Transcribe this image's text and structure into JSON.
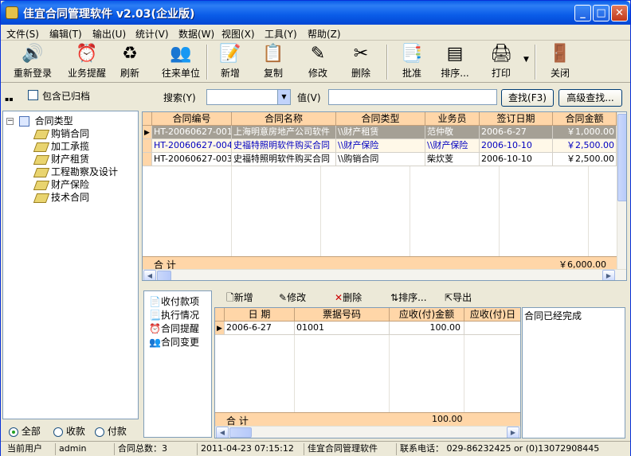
{
  "window": {
    "title": "佳宜合同管理软件 v2.03(企业版)"
  },
  "menu": [
    "文件(S)",
    "编辑(T)",
    "输出(U)",
    "统计(V)",
    "数据(W)",
    "视图(X)",
    "工具(Y)",
    "帮助(Z)"
  ],
  "toolbar": [
    {
      "label": "重新登录",
      "icon": "relogin-icon"
    },
    {
      "label": "业务提醒",
      "icon": "reminder-icon"
    },
    {
      "label": "刷新",
      "icon": "refresh-icon"
    },
    {
      "label": "往来单位",
      "icon": "partners-icon"
    },
    {
      "label": "新增",
      "icon": "new-icon"
    },
    {
      "label": "复制",
      "icon": "copy-icon"
    },
    {
      "label": "修改",
      "icon": "edit-icon"
    },
    {
      "label": "删除",
      "icon": "delete-icon"
    },
    {
      "label": "批准",
      "icon": "approve-icon"
    },
    {
      "label": "排序...",
      "icon": "sort-icon"
    },
    {
      "label": "打印",
      "icon": "print-icon"
    },
    {
      "label": "关闭",
      "icon": "close-door-icon"
    }
  ],
  "search": {
    "include_archived": "包含已归档",
    "search_label": "搜索(Y)",
    "value_label": "值(V)",
    "find_btn": "查找(F3)",
    "advanced_btn": "高级查找..."
  },
  "tree": {
    "root": "合同类型",
    "children": [
      "购销合同",
      "加工承揽",
      "财产租赁",
      "工程勘察及设计",
      "财产保险",
      "技术合同"
    ]
  },
  "contracts": {
    "headers": [
      "合同编号",
      "合同名称",
      "合同类型",
      "业务员",
      "签订日期",
      "合同金额"
    ],
    "rows": [
      [
        "HT-20060627-001",
        "上海明意房地产公司软件",
        "\\\\财产租赁",
        "范仲敬",
        "2006-6-27",
        "￥1,000.00"
      ],
      [
        "HT-20060627-004",
        "史福特照明软件购买合同",
        "\\\\财产保险",
        "\\\\财产保险",
        "2006-10-10",
        "￥2,500.00"
      ],
      [
        "HT-20060627-003",
        "史福特照明软件购买合同",
        "\\\\购销合同",
        "柴炊芰",
        "2006-10-10",
        "￥2,500.00"
      ]
    ],
    "total_label": "合 计",
    "total_amount": "￥6,000.00"
  },
  "detail": {
    "tabs": [
      "收付款项",
      "执行情况",
      "合同提醒",
      "合同变更"
    ],
    "toolbar": [
      "新增",
      "修改",
      "删除",
      "排序...",
      "导出"
    ],
    "headers": [
      "日   期",
      "票据号码",
      "应收(付)金额",
      "应收(付)日"
    ],
    "rows": [
      [
        "2006-6-27",
        "01001",
        "100.00",
        ""
      ]
    ],
    "total_label": "合 计",
    "total_amount": "100.00",
    "note": "合同已经完成"
  },
  "filter": {
    "all": "全部",
    "receive": "收款",
    "pay": "付款"
  },
  "status": {
    "user_label": "当前用户",
    "user": "admin",
    "count": "合同总数：3",
    "datetime": "2011-04-23 07:15:12",
    "app": "佳宜合同管理软件",
    "phone": "联系电话：  029-86232425  or  (0)13072908445"
  }
}
